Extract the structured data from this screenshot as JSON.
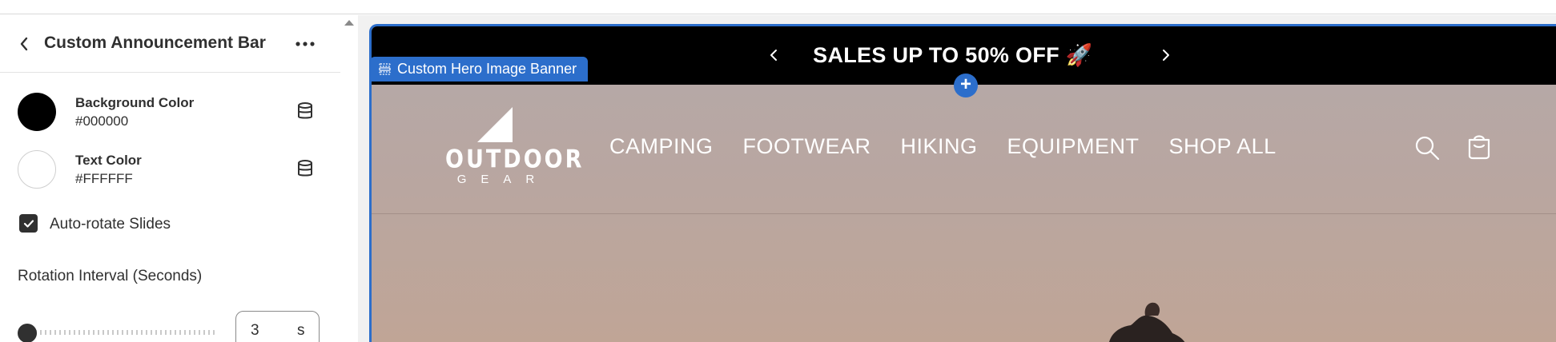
{
  "panel": {
    "title": "Custom Announcement Bar",
    "back_icon": "chevron-left-icon",
    "more_icon": "ellipsis-icon"
  },
  "settings": {
    "background_color": {
      "label": "Background Color",
      "value": "#000000",
      "swatch": "#000000",
      "source_icon": "database-icon"
    },
    "text_color": {
      "label": "Text Color",
      "value": "#FFFFFF",
      "swatch": "#FFFFFF",
      "source_icon": "database-icon"
    },
    "auto_rotate": {
      "label": "Auto-rotate Slides",
      "checked": true
    },
    "rotation_interval": {
      "label": "Rotation Interval (Seconds)",
      "value": "3",
      "suffix": "s",
      "slider_fraction": 0.0
    }
  },
  "preview": {
    "announcement_text": "SALES UP TO 50% OFF",
    "announcement_emoji": "🚀",
    "section_tag": "Custom Hero Image Banner",
    "logo": {
      "word": "OUTDOOR",
      "sub": "GEAR"
    },
    "nav_items": [
      "CAMPING",
      "FOOTWEAR",
      "HIKING",
      "EQUIPMENT",
      "SHOP ALL"
    ],
    "search_icon": "search-icon",
    "cart_icon": "cart-icon",
    "add_icon": "plus-icon"
  },
  "colors": {
    "accent": "#2c6ecb",
    "announcement_bg": "#000000",
    "hero_bg": "#b6a8a6"
  }
}
